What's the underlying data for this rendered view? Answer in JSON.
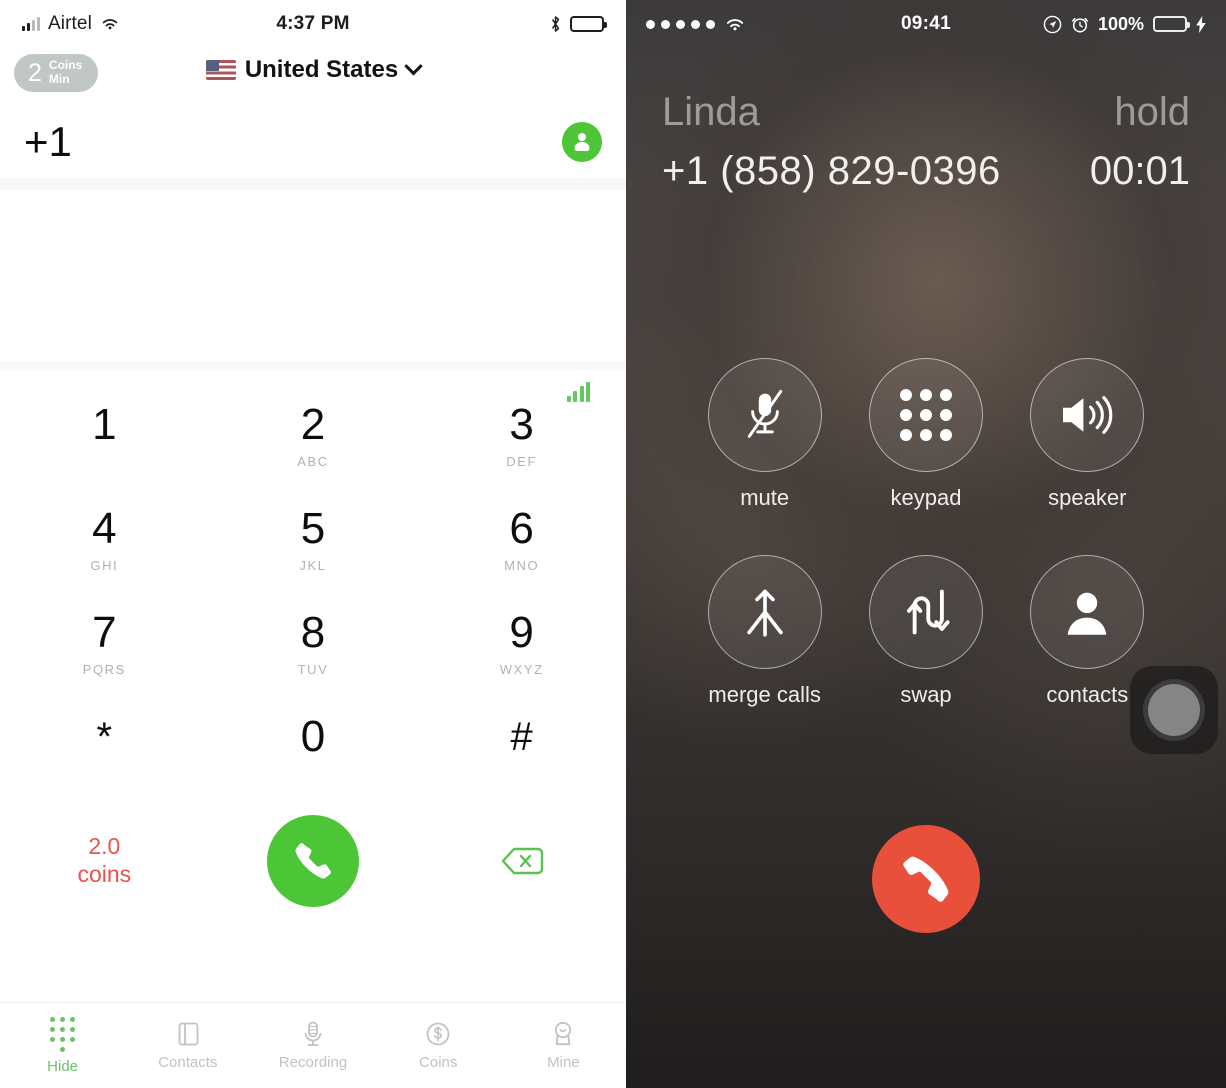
{
  "dialer": {
    "status_bar": {
      "carrier": "Airtel",
      "time": "4:37 PM",
      "wifi_icon": "wifi-icon",
      "bluetooth_icon": "bluetooth-icon",
      "battery_icon": "battery-icon"
    },
    "rate_badge": {
      "amount": "2",
      "unit_line1": "Coins",
      "unit_line2": "Min"
    },
    "country_selector": {
      "flag_icon": "flag-united-states-icon",
      "label": "United States",
      "chevron_icon": "chevron-down-icon"
    },
    "number_field": {
      "value": "+1",
      "add_contact_icon": "add-contact-icon"
    },
    "signal_indicator_icon": "signal-bars-icon",
    "keys": [
      {
        "digit": "1",
        "letters": ""
      },
      {
        "digit": "2",
        "letters": "ABC"
      },
      {
        "digit": "3",
        "letters": "DEF"
      },
      {
        "digit": "4",
        "letters": "GHI"
      },
      {
        "digit": "5",
        "letters": "JKL"
      },
      {
        "digit": "6",
        "letters": "MNO"
      },
      {
        "digit": "7",
        "letters": "PQRS"
      },
      {
        "digit": "8",
        "letters": "TUV"
      },
      {
        "digit": "9",
        "letters": "WXYZ"
      },
      {
        "digit": "*",
        "letters": ""
      },
      {
        "digit": "0",
        "letters": ""
      },
      {
        "digit": "#",
        "letters": ""
      }
    ],
    "cost": {
      "amount": "2.0",
      "unit": "coins"
    },
    "call_button_icon": "phone-handset-icon",
    "delete_button_icon": "backspace-delete-icon",
    "tabs": [
      {
        "label": "Hide",
        "icon": "keypad-dots-icon",
        "active": true
      },
      {
        "label": "Contacts",
        "icon": "contacts-book-icon",
        "active": false
      },
      {
        "label": "Recording",
        "icon": "microphone-icon",
        "active": false
      },
      {
        "label": "Coins",
        "icon": "dollar-coin-icon",
        "active": false
      },
      {
        "label": "Mine",
        "icon": "profile-person-icon",
        "active": false
      }
    ],
    "colors": {
      "accent_green": "#4cc537",
      "cost_red": "#e8544d",
      "inactive_gray": "#c2c2c4"
    }
  },
  "call_screen": {
    "status_bar": {
      "signal_dots": "5",
      "wifi_icon": "wifi-icon",
      "time": "09:41",
      "location_icon": "location-services-icon",
      "alarm_icon": "alarm-clock-icon",
      "battery_percent": "100%",
      "battery_icon": "battery-charging-icon",
      "bolt_icon": "lightning-bolt-icon"
    },
    "caller": {
      "name": "Linda",
      "state": "hold",
      "number": "+1 (858) 829-0396",
      "duration": "00:01"
    },
    "controls": [
      {
        "label": "mute",
        "icon": "microphone-muted-icon"
      },
      {
        "label": "keypad",
        "icon": "keypad-dots-icon"
      },
      {
        "label": "speaker",
        "icon": "speaker-volume-icon"
      },
      {
        "label": "merge calls",
        "icon": "merge-arrows-icon"
      },
      {
        "label": "swap",
        "icon": "swap-arrows-icon"
      },
      {
        "label": "contacts",
        "icon": "person-silhouette-icon"
      }
    ],
    "end_call_icon": "end-call-handset-icon",
    "assistive_touch_icon": "assistive-touch-icon",
    "colors": {
      "end_call_red": "#e8503c",
      "battery_green": "#5ddb52"
    }
  }
}
